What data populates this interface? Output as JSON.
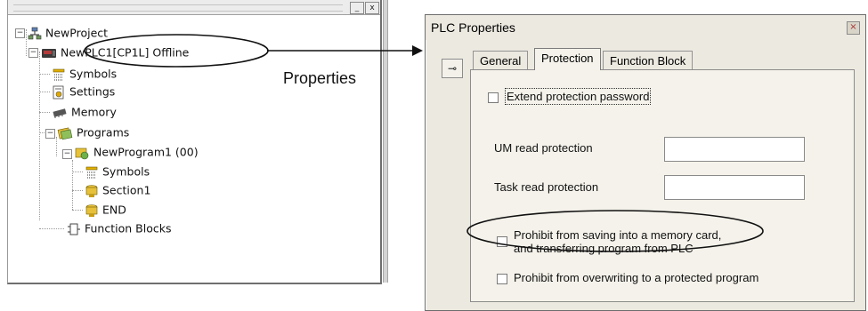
{
  "tree": {
    "title_buttons": [
      "_",
      "x"
    ],
    "project": "NewProject",
    "plc": "NewPLC1[CP1L] Offline",
    "children": [
      "Symbols",
      "Settings",
      "Memory",
      "Programs"
    ],
    "program": "NewProgram1 (00)",
    "program_children": [
      "Symbols",
      "Section1",
      "END"
    ],
    "function_blocks": "Function Blocks",
    "expanders": [
      "−",
      "−",
      "−",
      "−"
    ]
  },
  "annotation": {
    "label": "Properties"
  },
  "dialog": {
    "title": "PLC Properties",
    "close": "×",
    "pin": "⊸",
    "tabs": [
      "General",
      "Protection",
      "Function Block"
    ],
    "active_tab": "Protection",
    "options": {
      "extend_password": "Extend protection password",
      "um_read": "UM read protection",
      "task_read": "Task read protection",
      "prohibit_saving_line1": "Prohibit from saving into a memory card,",
      "prohibit_saving_line2": "and transferring program from PLC",
      "prohibit_overwrite": "Prohibit from overwriting to a protected program"
    },
    "fields": {
      "um_read_value": "",
      "task_read_value": ""
    },
    "checked": {
      "extend_password": false,
      "prohibit_saving": false,
      "prohibit_overwrite": false
    }
  }
}
